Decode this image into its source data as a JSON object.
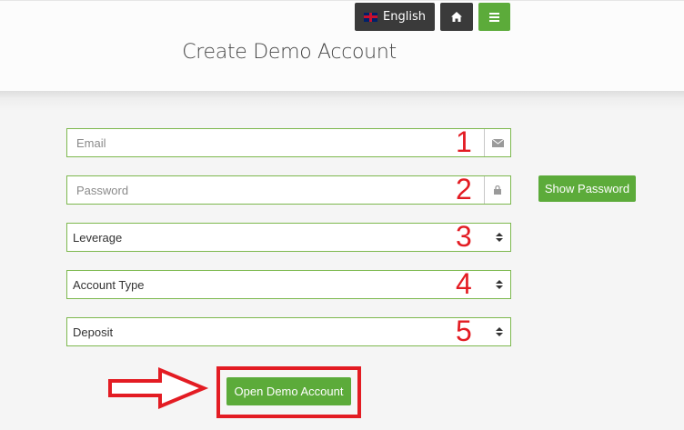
{
  "header": {
    "language_label": "English",
    "title": "Create Demo Account"
  },
  "form": {
    "email_placeholder": "Email",
    "password_placeholder": "Password",
    "leverage_value": "Leverage",
    "account_type_value": "Account Type",
    "deposit_value": "Deposit",
    "show_password_label": "Show Password",
    "submit_label": "Open Demo Account"
  },
  "annotations": {
    "step_numbers": [
      "1",
      "2",
      "3",
      "4",
      "5"
    ]
  },
  "colors": {
    "accent": "#5cab3a",
    "dark_button": "#3a3a3a",
    "annotation_red": "#e31c23"
  }
}
